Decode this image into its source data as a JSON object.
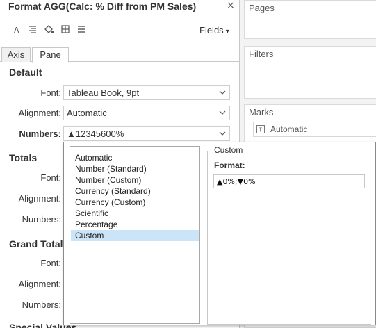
{
  "dialog": {
    "title": "Format AGG(Calc: % Diff from PM Sales)",
    "close_glyph": "×"
  },
  "toolbar": {
    "icons": [
      "font-icon",
      "alignment-icon",
      "shading-icon",
      "borders-icon",
      "lines-icon"
    ],
    "fields_label": "Fields",
    "fields_caret": "▾"
  },
  "tabs": [
    {
      "label": "Axis",
      "active": false
    },
    {
      "label": "Pane",
      "active": true
    }
  ],
  "default_section": {
    "title": "Default",
    "font_label": "Font:",
    "font_value": "Tableau Book, 9pt",
    "alignment_label": "Alignment:",
    "alignment_value": "Automatic",
    "numbers_label": "Numbers:",
    "numbers_value": "▲12345600%"
  },
  "totals_section": {
    "title": "Totals",
    "font_label": "Font:",
    "alignment_label": "Alignment:",
    "numbers_label": "Numbers:"
  },
  "grand_totals_section": {
    "title": "Grand Totals",
    "font_label": "Font:",
    "alignment_label": "Alignment:",
    "numbers_label": "Numbers:"
  },
  "special_values_section": {
    "title": "Special Values"
  },
  "cards": {
    "pages_title": "Pages",
    "filters_title": "Filters",
    "marks_title": "Marks",
    "marks_type": "Automatic"
  },
  "number_format_popup": {
    "categories": [
      {
        "label": "Automatic",
        "selected": false
      },
      {
        "label": "Number (Standard)",
        "selected": false
      },
      {
        "label": "Number (Custom)",
        "selected": false
      },
      {
        "label": "Currency (Standard)",
        "selected": false
      },
      {
        "label": "Currency (Custom)",
        "selected": false
      },
      {
        "label": "Scientific",
        "selected": false
      },
      {
        "label": "Percentage",
        "selected": false
      },
      {
        "label": "Custom",
        "selected": true
      }
    ],
    "group_title": "Custom",
    "format_label": "Format:",
    "format_value": "▲0%;▼0%"
  },
  "colors": {
    "selection_highlight": "#cce4f7",
    "card_area_background": "#f3f3f3",
    "border": "#c8c8c8"
  }
}
